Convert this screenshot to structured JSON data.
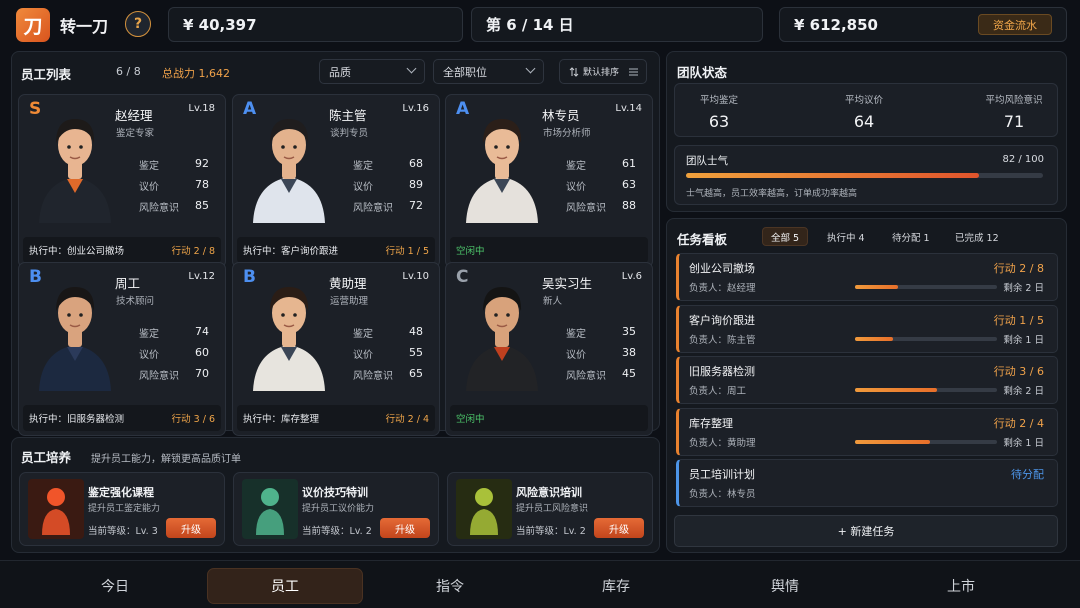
{
  "topbar": {
    "logo_char": "刀",
    "app_title": "转一刀",
    "help_label": "?",
    "cash": "¥ 40,397",
    "day": "第 6 / 14 日",
    "assets": "¥ 612,850",
    "cashflow_label": "资金流水"
  },
  "staff": {
    "title": "员工列表",
    "count": "6 / 8",
    "total_label": "总战力",
    "total_value": "1,642",
    "quality_select": "品质",
    "position_select": "全部职位",
    "sort_label": "默认排序",
    "stat_labels": [
      "鉴定",
      "议价",
      "风险意识"
    ],
    "cards": [
      {
        "grade": "S",
        "level": "Lv.18",
        "name": "赵经理",
        "role": "鉴定专家",
        "stats": [
          "92",
          "78",
          "85"
        ],
        "task": "执行中：创业公司撤场",
        "progress": "行动 2 / 8",
        "idle": ""
      },
      {
        "grade": "A",
        "level": "Lv.16",
        "name": "陈主管",
        "role": "谈判专员",
        "stats": [
          "68",
          "89",
          "72"
        ],
        "task": "执行中：客户询价跟进",
        "progress": "行动 1 / 5",
        "idle": ""
      },
      {
        "grade": "A",
        "level": "Lv.14",
        "name": "林专员",
        "role": "市场分析师",
        "stats": [
          "61",
          "63",
          "88"
        ],
        "task": "",
        "progress": "",
        "idle": "空闲中"
      },
      {
        "grade": "B",
        "level": "Lv.12",
        "name": "周工",
        "role": "技术顾问",
        "stats": [
          "74",
          "60",
          "70"
        ],
        "task": "执行中：旧服务器检测",
        "progress": "行动 3 / 6",
        "idle": ""
      },
      {
        "grade": "B",
        "level": "Lv.10",
        "name": "黄助理",
        "role": "运营助理",
        "stats": [
          "48",
          "55",
          "65"
        ],
        "task": "执行中：库存整理",
        "progress": "行动 2 / 4",
        "idle": ""
      },
      {
        "grade": "C",
        "level": "Lv.6",
        "name": "吴实习生",
        "role": "新人",
        "stats": [
          "35",
          "38",
          "45"
        ],
        "task": "",
        "progress": "",
        "idle": "空闲中"
      }
    ],
    "grade_colors": {
      "S": "#f08a36",
      "A": "#4d8ff0",
      "B": "#4d8ff0",
      "C": "#9aa1ab"
    }
  },
  "training": {
    "title": "员工培养",
    "subtitle": "提升员工能力，解锁更高品质订单",
    "courses": [
      {
        "name": "鉴定强化课程",
        "desc": "提升员工鉴定能力",
        "level": "当前等级：Lv. 3",
        "button": "升级",
        "icon": "appraisal-figure-icon"
      },
      {
        "name": "议价技巧特训",
        "desc": "提升员工议价能力",
        "level": "当前等级：Lv. 2",
        "button": "升级",
        "icon": "negotiation-figure-icon"
      },
      {
        "name": "风险意识培训",
        "desc": "提升员工风险意识",
        "level": "当前等级：Lv. 2",
        "button": "升级",
        "icon": "risk-figure-icon"
      }
    ]
  },
  "team": {
    "title": "团队状态",
    "avgs": [
      {
        "label": "平均鉴定",
        "value": "63"
      },
      {
        "label": "平均议价",
        "value": "64"
      },
      {
        "label": "平均风险意识",
        "value": "71"
      }
    ],
    "morale_label": "团队士气",
    "morale_value": "82 / 100",
    "morale_fraction": 0.82,
    "morale_note": "士气越高，员工效率越高，订单成功率越高"
  },
  "tasks": {
    "title": "任务看板",
    "tabs": [
      "全部 5",
      "执行中 4",
      "待分配 1",
      "已完成 12"
    ],
    "items": [
      {
        "name": "创业公司撤场",
        "owner": "负责人：赵经理",
        "progress": "行动 2 / 8",
        "remaining": "剩余 2 日",
        "fraction": 0.3,
        "pending": false
      },
      {
        "name": "客户询价跟进",
        "owner": "负责人：陈主管",
        "progress": "行动 1 / 5",
        "remaining": "剩余 1 日",
        "fraction": 0.27,
        "pending": false
      },
      {
        "name": "旧服务器检测",
        "owner": "负责人：周工",
        "progress": "行动 3 / 6",
        "remaining": "剩余 2 日",
        "fraction": 0.58,
        "pending": false
      },
      {
        "name": "库存整理",
        "owner": "负责人：黄助理",
        "progress": "行动 2 / 4",
        "remaining": "剩余 1 日",
        "fraction": 0.53,
        "pending": false
      },
      {
        "name": "员工培训计划",
        "owner": "负责人：林专员",
        "progress": "待分配",
        "remaining": "",
        "fraction": 0,
        "pending": true
      }
    ],
    "new_task": "+ 新建任务"
  },
  "nav": [
    "今日",
    "员工",
    "指令",
    "库存",
    "舆情",
    "上市"
  ],
  "colors": {
    "accent": "#e9822f",
    "pending": "#4d95e8",
    "idle": "#4cc46a"
  }
}
